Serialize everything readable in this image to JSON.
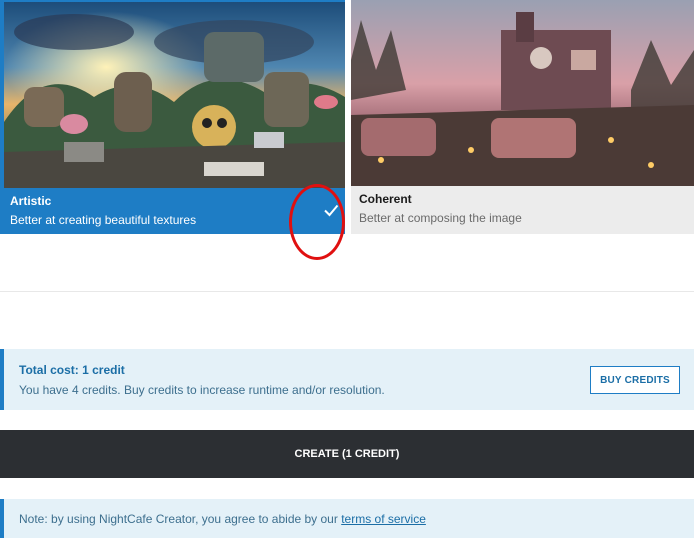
{
  "styles": [
    {
      "title": "Artistic",
      "description": "Better at creating beautiful textures",
      "selected": true
    },
    {
      "title": "Coherent",
      "description": "Better at composing the image",
      "selected": false
    }
  ],
  "cost": {
    "title": "Total cost: 1 credit",
    "text": "You have 4 credits. Buy credits to increase runtime and/or resolution.",
    "buy_label": "BUY CREDITS"
  },
  "create_label": "CREATE (1 CREDIT)",
  "note": {
    "prefix": "Note: by using NightCafe Creator, you agree to abide by our ",
    "link": "terms of service"
  },
  "icons": {
    "selected": "checkmark-icon"
  },
  "colors": {
    "accent": "#1e7dc5",
    "create_bg": "#2c2f33",
    "annotation": "#e01010",
    "panel_bg": "#e4f1f8"
  }
}
